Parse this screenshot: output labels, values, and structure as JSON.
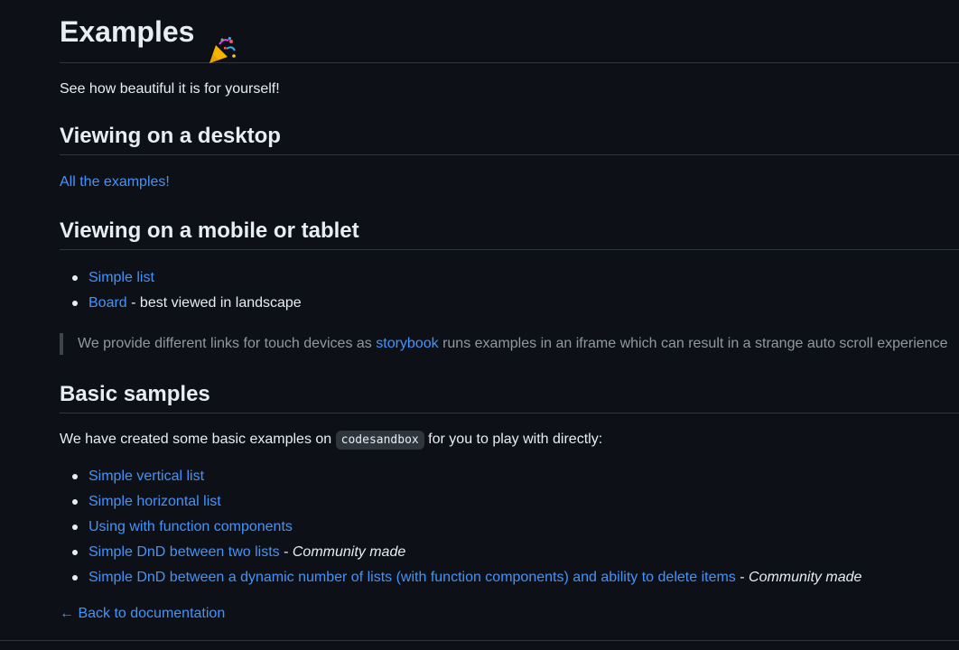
{
  "heading": {
    "title": "Examples",
    "icon": "party-popper-icon"
  },
  "intro": "See how beautiful it is for yourself!",
  "desktop": {
    "heading": "Viewing on a desktop",
    "link": "All the examples!"
  },
  "mobile": {
    "heading": "Viewing on a mobile or tablet",
    "items": [
      {
        "link": "Simple list",
        "suffix": ""
      },
      {
        "link": "Board",
        "suffix": " - best viewed in landscape"
      }
    ],
    "note": {
      "before": "We provide different links for touch devices as ",
      "link": "storybook",
      "after": " runs examples in an iframe which can result in a strange auto scroll experience"
    }
  },
  "basic": {
    "heading": "Basic samples",
    "intro_before": "We have created some basic examples on ",
    "code": "codesandbox",
    "intro_after": " for you to play with directly:",
    "items": [
      {
        "link": "Simple vertical list",
        "sep": "",
        "em": ""
      },
      {
        "link": "Simple horizontal list",
        "sep": "",
        "em": ""
      },
      {
        "link": "Using with function components",
        "sep": "",
        "em": ""
      },
      {
        "link": "Simple DnD between two lists",
        "sep": " - ",
        "em": "Community made"
      },
      {
        "link": "Simple DnD between a dynamic number of lists (with function components) and ability to delete items",
        "sep": " - ",
        "em": "Community made"
      }
    ]
  },
  "back_link": "← Back to documentation",
  "colors": {
    "background": "#0d1117",
    "text": "#e6edf3",
    "link": "#4493f8",
    "muted": "#9198a1",
    "border": "#30363d"
  }
}
